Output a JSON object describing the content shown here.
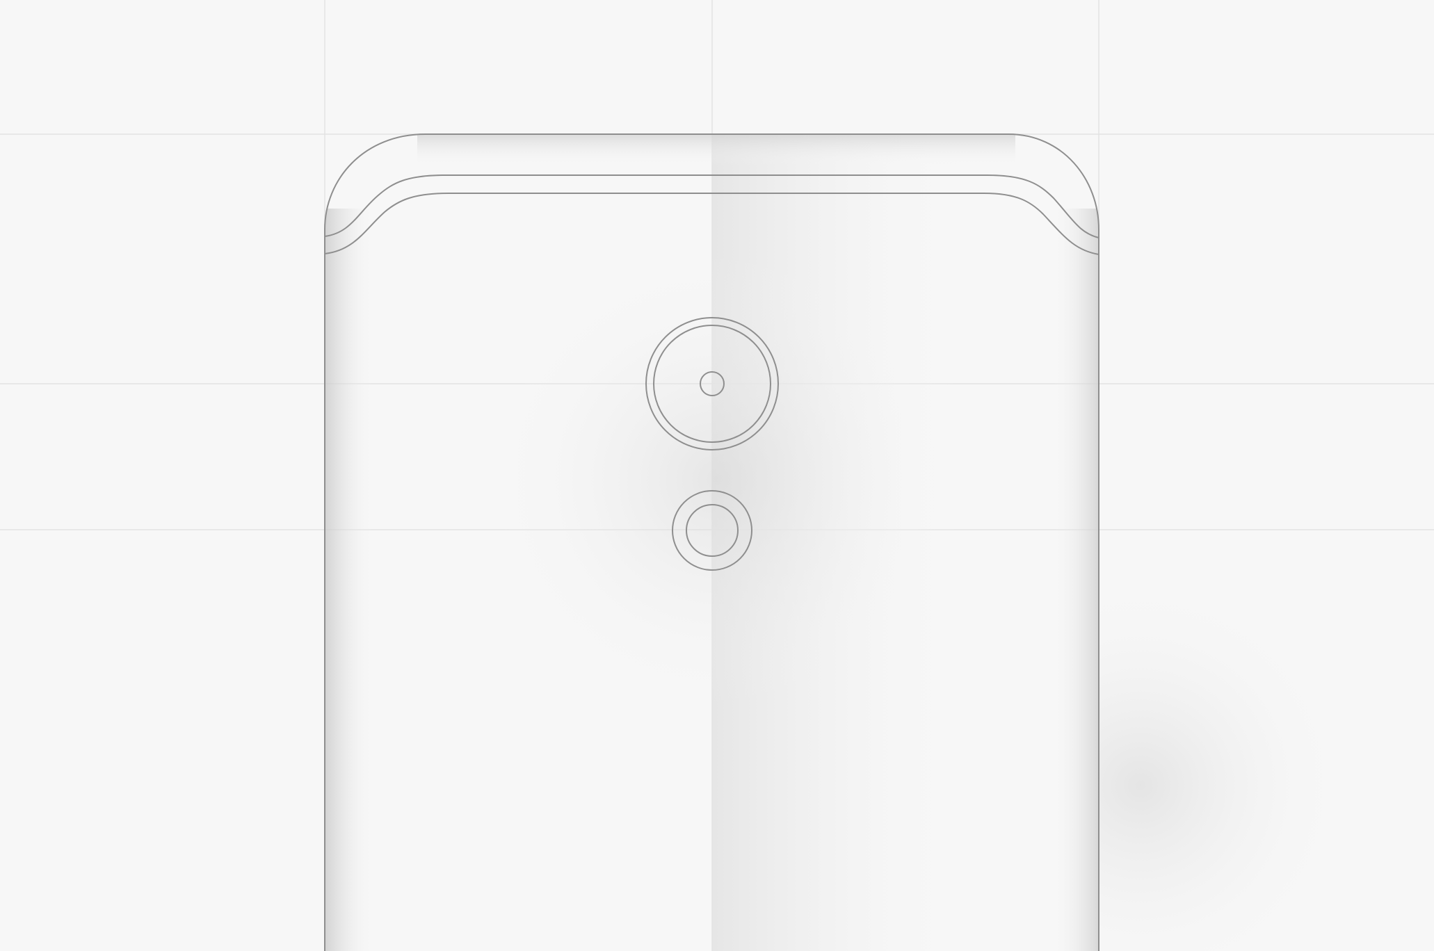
{
  "illustration": {
    "subject": "phone-back-outline",
    "colors": {
      "background": "#f7f7f7",
      "grid_line": "#e2e2e2",
      "outline": "#8c8c8c",
      "shadow": "#d4d4d4"
    },
    "parts": [
      {
        "name": "phone-body"
      },
      {
        "name": "top-edge-curve"
      },
      {
        "name": "camera-lens-main"
      },
      {
        "name": "camera-lens-secondary"
      }
    ]
  }
}
